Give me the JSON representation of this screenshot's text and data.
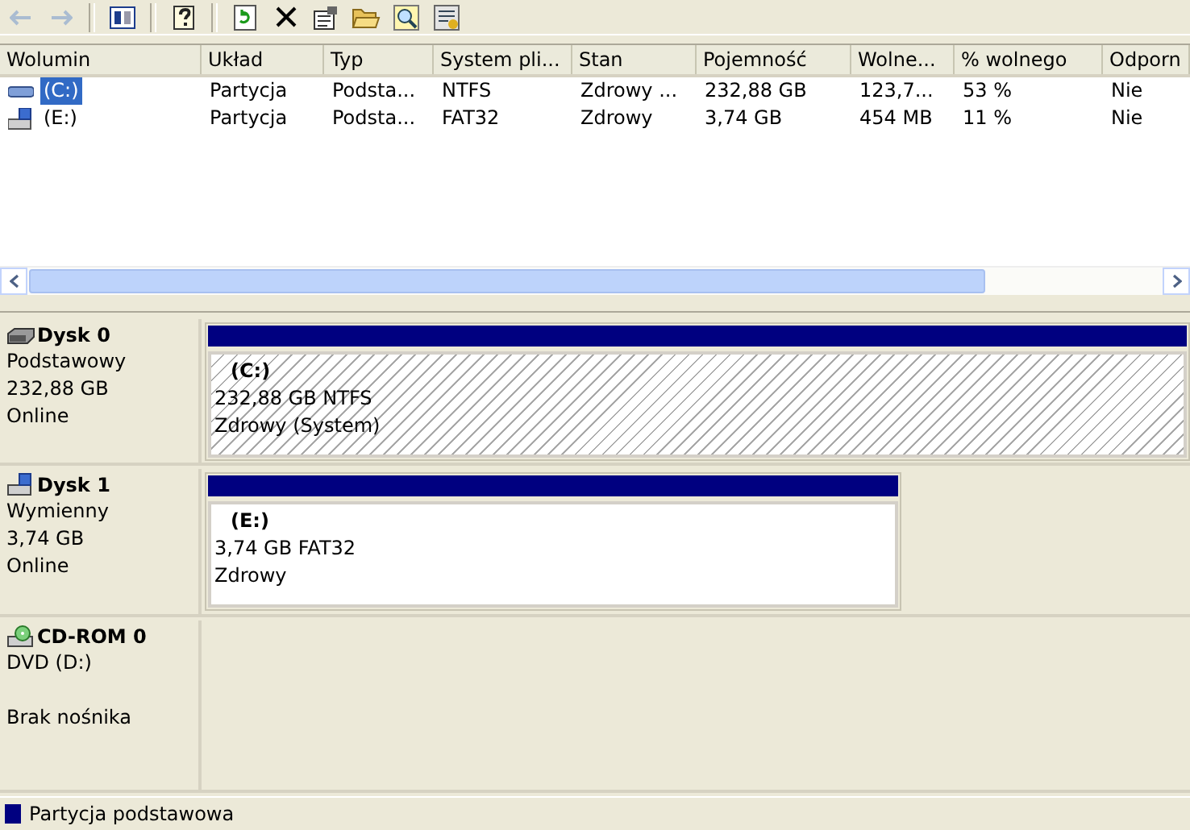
{
  "toolbar": [
    {
      "kind": "back",
      "disabled": true
    },
    {
      "kind": "forward",
      "disabled": true
    },
    {
      "kind": "sep"
    },
    {
      "kind": "panes",
      "disabled": false
    },
    {
      "kind": "sep"
    },
    {
      "kind": "help",
      "disabled": false
    },
    {
      "kind": "sep"
    },
    {
      "kind": "refresh",
      "disabled": false
    },
    {
      "kind": "delete",
      "disabled": false
    },
    {
      "kind": "properties",
      "disabled": false
    },
    {
      "kind": "open",
      "disabled": false
    },
    {
      "kind": "explore",
      "disabled": false
    },
    {
      "kind": "wizard",
      "disabled": false
    }
  ],
  "table": {
    "columns": [
      "Wolumin",
      "Układ",
      "Typ",
      "System pli...",
      "Stan",
      "Pojemność",
      "Wolne...",
      "% wolnego",
      "Odporn"
    ],
    "rows": [
      {
        "kind": "basic",
        "selected": true,
        "cells": [
          "(C:)",
          "Partycja",
          "Podsta...",
          "NTFS",
          "Zdrowy ...",
          "232,88 GB",
          "123,7...",
          "53 %",
          "Nie"
        ]
      },
      {
        "kind": "removable",
        "selected": false,
        "cells": [
          "(E:)",
          "Partycja",
          "Podsta...",
          "FAT32",
          "Zdrowy",
          "3,74 GB",
          "454 MB",
          "11 %",
          "Nie"
        ]
      }
    ]
  },
  "disks": [
    {
      "kind": "disk",
      "name": "Dysk 0",
      "lines": [
        "Podstawowy",
        "232,88 GB",
        "Online"
      ],
      "partitions": [
        {
          "name": "(C:)",
          "size": "232,88 GB NTFS",
          "status": "Zdrowy (System)",
          "selected": true
        }
      ]
    },
    {
      "kind": "removable",
      "name": "Dysk 1",
      "lines": [
        "Wymienny",
        "3,74 GB",
        "Online"
      ],
      "partitions": [
        {
          "name": "(E:)",
          "size": "3,74 GB FAT32",
          "status": "Zdrowy",
          "selected": false
        }
      ]
    },
    {
      "kind": "cdrom",
      "name": "CD-ROM 0",
      "lines": [
        "DVD (D:)",
        "Brak nośnika"
      ]
    }
  ],
  "legend": [
    {
      "label": "Partycja podstawowa",
      "color": "#000080"
    }
  ]
}
